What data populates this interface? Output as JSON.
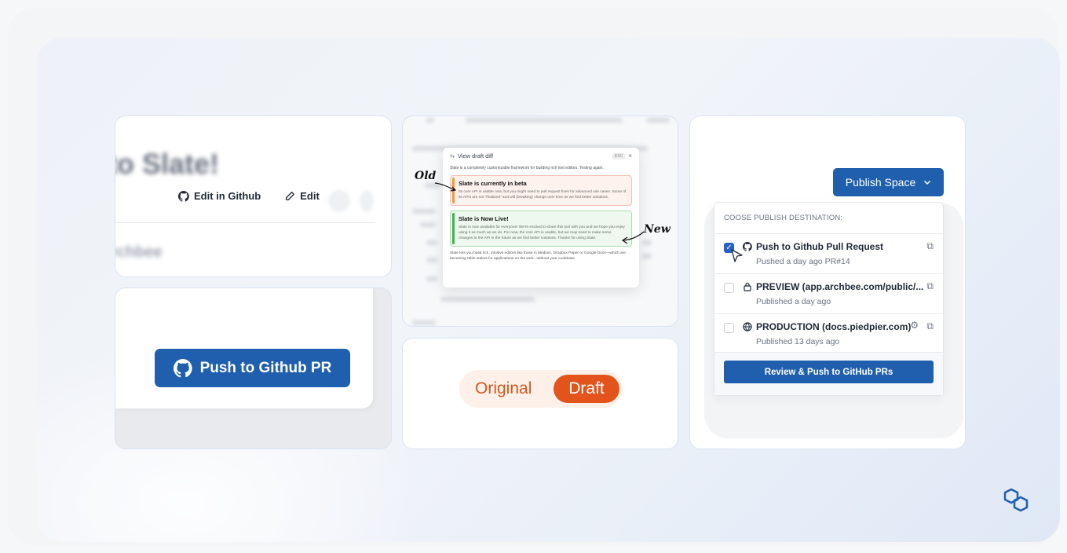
{
  "card_edit": {
    "title_fragment": "to Slate!",
    "edit_in_github": "Edit in Github",
    "edit": "Edit",
    "subtitle_fragment": "rchbee"
  },
  "card_push": {
    "button": "Push to Github PR"
  },
  "card_diff": {
    "annotation_old": "Old",
    "annotation_new": "New",
    "modal_title": "View draft diff",
    "esc": "ESC",
    "close": "×",
    "intro": "Slate is a completely customizable framework for building rich text editors. Testing again.",
    "old_title": "Slate is currently in beta",
    "old_body": "Its core API is usable now, but you might need to pull request fixes for advanced use cases. Some of its APIs are not \"finalized\" and will (breaking) change over time as we find better solutions.",
    "new_title": "Slate is Now Live!",
    "new_body": "Slate is now available for everyone! We're excited to share this tool with you and we hope you enjoy using it as much as we do. For now, the core API is usable, but we may need to make some changes to the API in the future as we find better solutions. Thanks for using Slate.",
    "footer": "Slate lets you build rich, intuitive editors like those in Medium, Dropbox Paper or Google Docs—which are becoming table stakes for applications on the web—without your codebase"
  },
  "card_toggle": {
    "original": "Original",
    "draft": "Draft"
  },
  "card_publish": {
    "publish_button": "Publish Space",
    "header": "COOSE PUBLISH DESTINATION:",
    "destinations": [
      {
        "title": "Push to Github Pull Request",
        "subtitle": "Pushed a day ago PR#14",
        "checked": true
      },
      {
        "title": "PREVIEW (app.archbee.com/public/...",
        "subtitle": "Published a day ago",
        "checked": false
      },
      {
        "title": "PRODUCTION (docs.piedpier.com)",
        "subtitle": "Published 13 days ago",
        "checked": false
      }
    ],
    "review_button": "Review & Push to GitHub PRs"
  },
  "colors": {
    "primary_blue": "#1f5fae",
    "draft_orange": "#e2541b",
    "old_accent": "#f29a36",
    "new_accent": "#3fb34f"
  }
}
